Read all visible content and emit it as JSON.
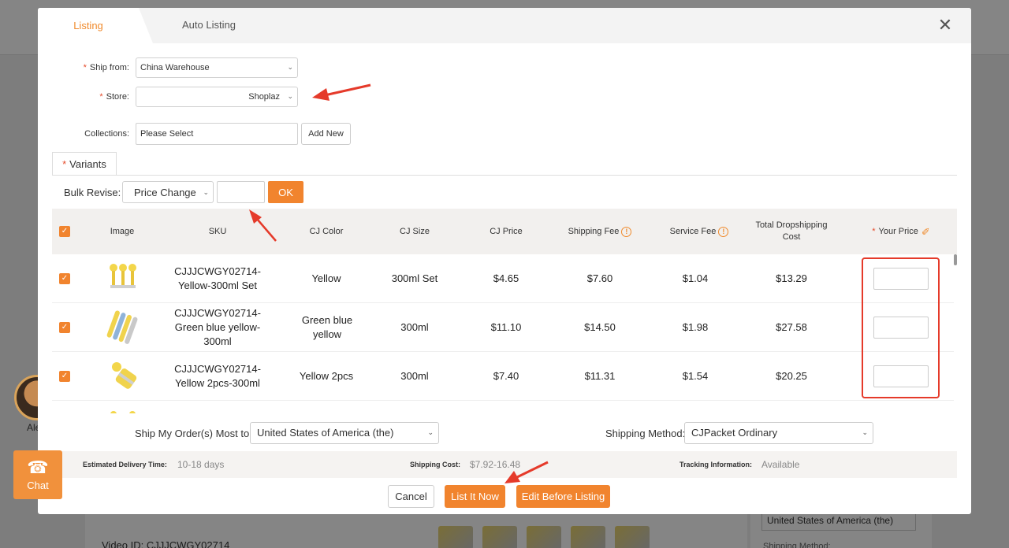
{
  "background": {
    "video_id": "Video ID: CJJJCWGY02714",
    "country": "United States of America (the)",
    "shipping_method_label": "Shipping Method:",
    "agent_name": "Ale"
  },
  "chat_widget": {
    "label": "Chat",
    "icon": "headset-icon"
  },
  "modal": {
    "tabs": {
      "active": "Listing",
      "other": "Auto Listing"
    },
    "form": {
      "ship_from_label": "Ship from:",
      "ship_from_value": "China Warehouse",
      "store_label": "Store:",
      "store_value": "Shoplaz",
      "collections_label": "Collections:",
      "collections_placeholder": "Please Select",
      "add_new": "Add New"
    },
    "variants_tab": "Variants",
    "bulk": {
      "label": "Bulk Revise:",
      "select": "Price Change",
      "ok": "OK"
    },
    "table": {
      "headers": {
        "image": "Image",
        "sku": "SKU",
        "cj_color": "CJ Color",
        "cj_size": "CJ Size",
        "cj_price": "CJ Price",
        "shipping_fee": "Shipping Fee",
        "service_fee": "Service Fee",
        "total_cost": "Total Dropshipping Cost",
        "your_price": "Your Price"
      },
      "rows": [
        {
          "sku": "CJJJCWGY02714-Yellow-300ml Set",
          "color": "Yellow",
          "size": "300ml Set",
          "cj_price": "$4.65",
          "shipping_fee": "$7.60",
          "service_fee": "$1.04",
          "total": "$13.29"
        },
        {
          "sku": "CJJJCWGY02714-Green blue yellow-300ml",
          "color": "Green blue yellow",
          "size": "300ml",
          "cj_price": "$11.10",
          "shipping_fee": "$14.50",
          "service_fee": "$1.98",
          "total": "$27.58"
        },
        {
          "sku": "CJJJCWGY02714-Yellow 2pcs-300ml",
          "color": "Yellow 2pcs",
          "size": "300ml",
          "cj_price": "$7.40",
          "shipping_fee": "$11.31",
          "service_fee": "$1.54",
          "total": "$20.25"
        }
      ]
    },
    "shipping": {
      "ship_to_label": "Ship My Order(s) Most to:",
      "ship_to_value": "United States of America (the)",
      "method_label": "Shipping Method:",
      "method_value": "CJPacket Ordinary"
    },
    "info": {
      "delivery_label": "Estimated Delivery Time:",
      "delivery_value": "10-18 days",
      "cost_label": "Shipping Cost:",
      "cost_value": "$7.92-16.48",
      "tracking_label": "Tracking Information:",
      "tracking_value": "Available"
    },
    "actions": {
      "cancel": "Cancel",
      "list_now": "List It Now",
      "edit_before": "Edit Before Listing"
    }
  },
  "colors": {
    "accent": "#f1842e",
    "annotation": "#e53a2a"
  }
}
